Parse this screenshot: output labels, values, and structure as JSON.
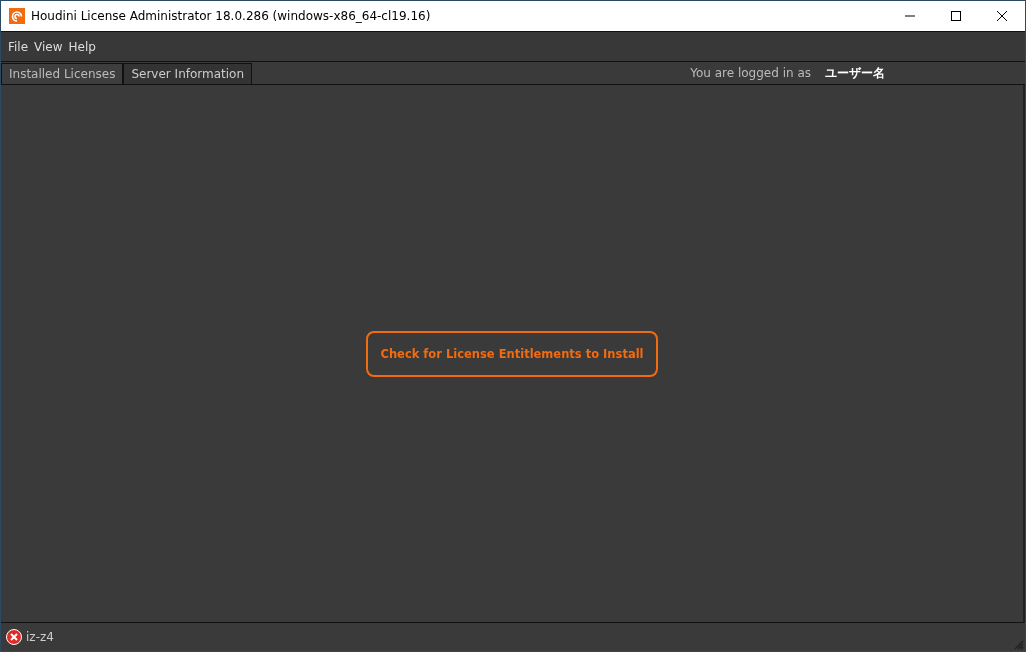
{
  "window": {
    "title": "Houdini License Administrator 18.0.286 (windows-x86_64-cl19.16)"
  },
  "menu": [
    "File",
    "View",
    "Help"
  ],
  "tabs": [
    {
      "label": "Installed Licenses",
      "selected": true
    },
    {
      "label": "Server Information",
      "selected": false
    }
  ],
  "login": {
    "label": "You are logged in as",
    "user": "ユーザー名"
  },
  "main_button": "Check for License Entitlements to Install",
  "status_bar": {
    "kind": "error",
    "text": "iz-z4"
  }
}
